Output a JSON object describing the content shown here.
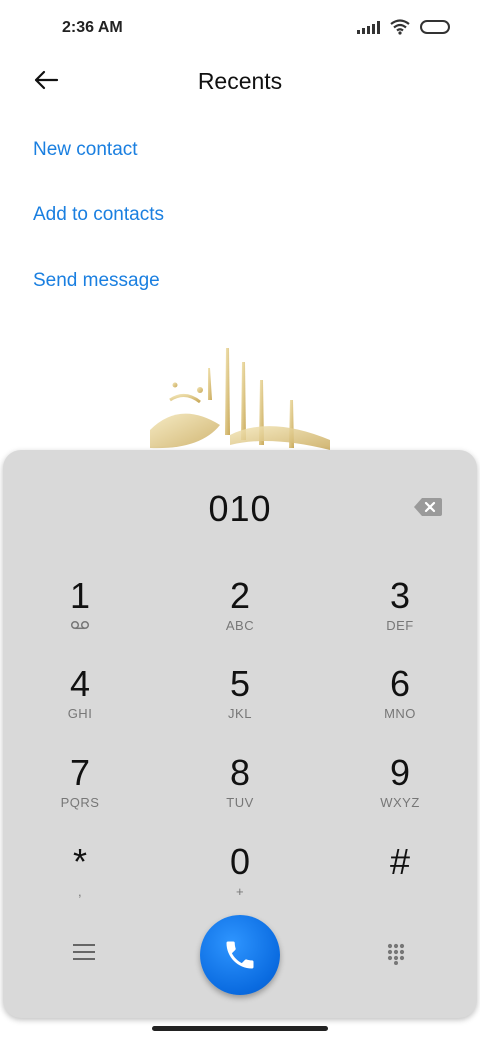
{
  "status_bar": {
    "time": "2:36 AM"
  },
  "header": {
    "title": "Recents"
  },
  "actions": [
    {
      "label": "New contact"
    },
    {
      "label": "Add to contacts"
    },
    {
      "label": "Send message"
    }
  ],
  "dialpad": {
    "number": "010",
    "keys": [
      {
        "digit": "1",
        "letters": ""
      },
      {
        "digit": "2",
        "letters": "ABC"
      },
      {
        "digit": "3",
        "letters": "DEF"
      },
      {
        "digit": "4",
        "letters": "GHI"
      },
      {
        "digit": "5",
        "letters": "JKL"
      },
      {
        "digit": "6",
        "letters": "MNO"
      },
      {
        "digit": "7",
        "letters": "PQRS"
      },
      {
        "digit": "8",
        "letters": "TUV"
      },
      {
        "digit": "9",
        "letters": "WXYZ"
      },
      {
        "digit": "*",
        "letters": ","
      },
      {
        "digit": "0",
        "letters": "+"
      },
      {
        "digit": "#",
        "letters": ""
      }
    ]
  },
  "colors": {
    "accent": "#1a7fe0",
    "dialpad_bg": "#d9d9d9",
    "call_button": "#0a6be0"
  }
}
